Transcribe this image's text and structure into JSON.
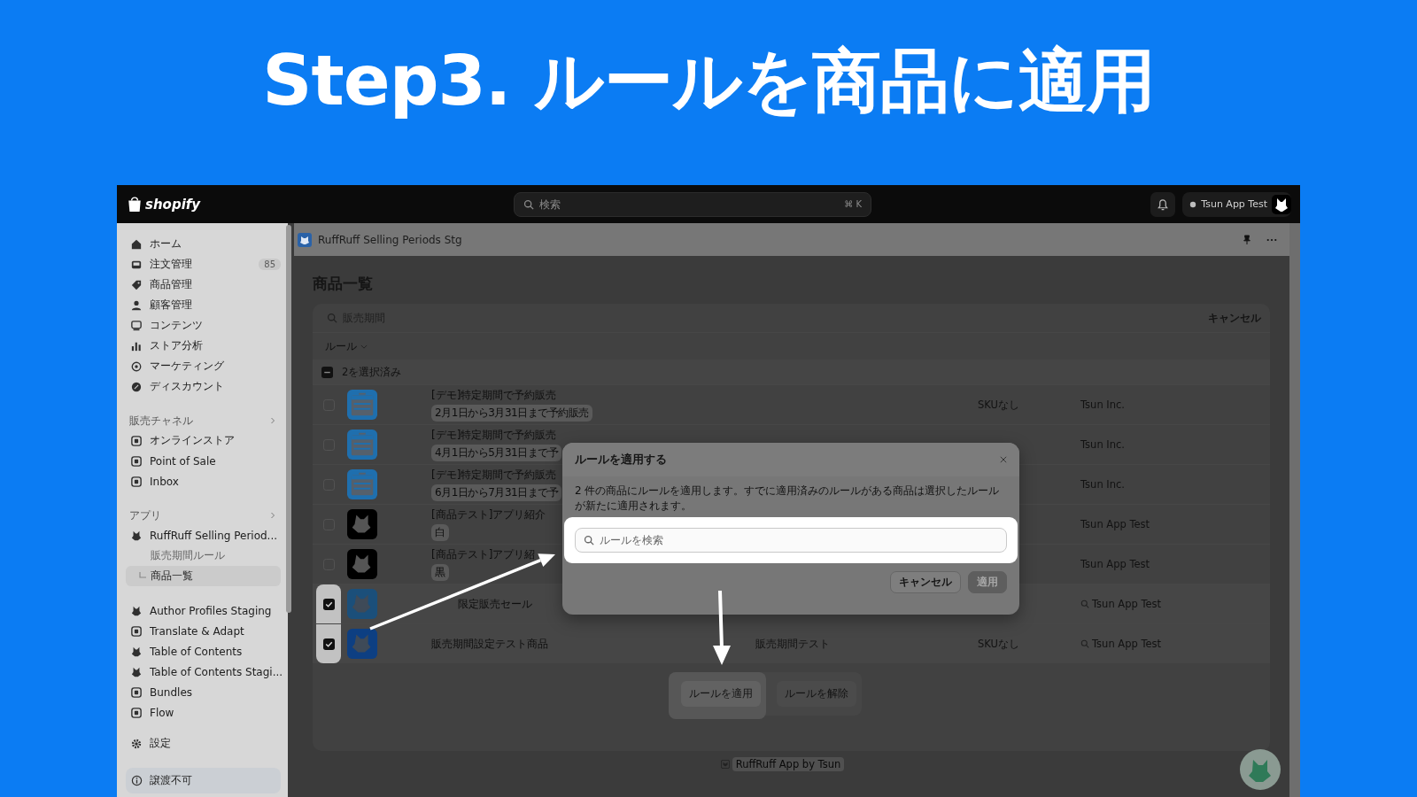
{
  "headline": "Step3. ルールを商品に適用",
  "topbar": {
    "logo": "shopify",
    "search": {
      "placeholder": "検索",
      "shortcut": "⌘ K"
    },
    "store": "Tsun App Test"
  },
  "sidebar": {
    "items": [
      {
        "label": "ホーム"
      },
      {
        "label": "注文管理",
        "count": "85"
      },
      {
        "label": "商品管理"
      },
      {
        "label": "顧客管理"
      },
      {
        "label": "コンテンツ"
      },
      {
        "label": "ストア分析"
      },
      {
        "label": "マーケティング"
      },
      {
        "label": "ディスカウント"
      }
    ],
    "sections": [
      {
        "title": "販売チャネル",
        "items": [
          {
            "label": "オンラインストア"
          },
          {
            "label": "Point of Sale"
          },
          {
            "label": "Inbox"
          }
        ]
      },
      {
        "title": "アプリ",
        "items": [
          {
            "label": "RuffRuff Selling Period...",
            "children": [
              {
                "label": "販売期間ルール",
                "selected": false
              },
              {
                "label": "商品一覧",
                "selected": true
              }
            ]
          }
        ]
      }
    ],
    "apps": [
      {
        "label": "Author Profiles Staging"
      },
      {
        "label": "Translate & Adapt"
      },
      {
        "label": "Table of Contents"
      },
      {
        "label": "Table of Contents Stagi..."
      },
      {
        "label": "Bundles"
      },
      {
        "label": "Flow"
      }
    ],
    "settings": "設定",
    "notice": "譲渡不可"
  },
  "app_header": {
    "title": "RuffRuff Selling Periods Stg"
  },
  "page": {
    "title": "商品一覧",
    "search": {
      "placeholder": "販売期間"
    },
    "cancel": "キャンセル",
    "filter": "ルール",
    "bulk": {
      "label": "2を選択済み",
      "indeterminate": true
    },
    "rows": [
      {
        "title": "[デモ]特定期間で予約販売",
        "tag": "2月1日から3月31日まで予約販売",
        "sku": "SKUなし",
        "vendor": "Tsun Inc.",
        "selected": false
      },
      {
        "title": "[デモ]特定期間で予約販売",
        "tag": "4月1日から5月31日まで予",
        "vendor": "Tsun Inc.",
        "selected": false
      },
      {
        "title": "[デモ]特定期間で予約販売",
        "tag": "6月1日から7月31日まで予",
        "vendor": "Tsun Inc.",
        "selected": false
      },
      {
        "title": "[商品テスト]アプリ紹介",
        "tag": "白",
        "vendor": "Tsun App Test",
        "selected": false
      },
      {
        "title": "[商品テスト]アプリ紹",
        "tag": "黒",
        "vendor": "Tsun App Test",
        "selected": false
      },
      {
        "title": "限定販売セール",
        "vendor": "Tsun App Test",
        "vendor_mark": true,
        "selected": true
      },
      {
        "title": "販売期間設定テスト商品",
        "rule": "販売期間テスト",
        "sku": "SKUなし",
        "vendor": "Tsun App Test",
        "vendor_mark": true,
        "selected": true
      }
    ],
    "bulk_actions": [
      {
        "label": "ルールを適用",
        "highlighted": true
      },
      {
        "label": "ルールを解除",
        "highlighted": false
      }
    ],
    "footer": "RuffRuff App by Tsun"
  },
  "modal": {
    "title": "ルールを適用する",
    "text": "2 件の商品にルールを適用します。すでに適用済みのルールがある商品は選択したルールが新たに適用されます。",
    "search": {
      "placeholder": "ルールを検索"
    },
    "buttons": [
      {
        "label": "キャンセル",
        "disabled": false
      },
      {
        "label": "適用",
        "disabled": true
      }
    ]
  }
}
